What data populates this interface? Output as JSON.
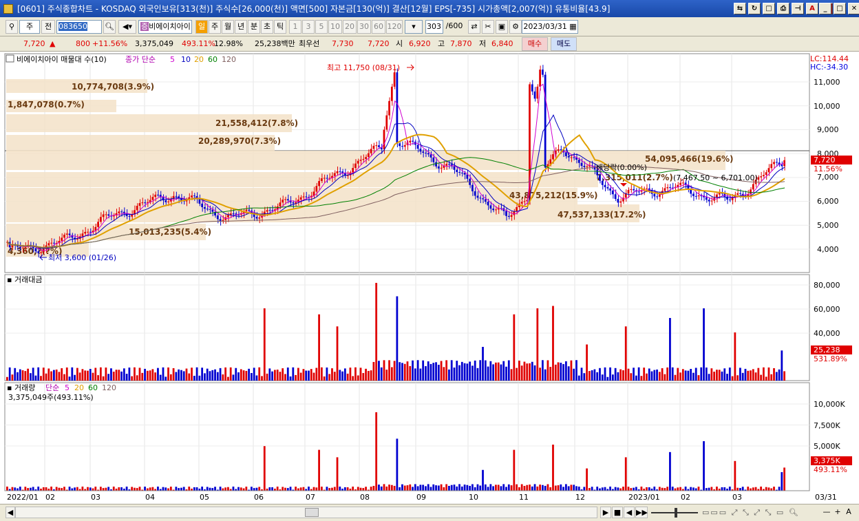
{
  "window": {
    "title": "[0601] 주식종합차트 - KOSDAQ 외국인보유[313(천)] 주식수[26,000(천)] 액면[500] 자본금[130(억)] 결산[12월] EPS[-735] 시가총액[2,007(억)] 유통비율[43.9]",
    "buttons": [
      "▣",
      "?"
    ]
  },
  "toolbar": {
    "period_select": "주",
    "prev_label": "전",
    "stock_code": "083650",
    "stock_name": "비에이치아이",
    "timeframes": [
      "일",
      "주",
      "월",
      "년",
      "분",
      "초",
      "틱"
    ],
    "minute_options": [
      "1",
      "3",
      "5",
      "10",
      "20",
      "30",
      "60",
      "120"
    ],
    "count": "303",
    "count_total": "/600",
    "date": "2023/03/31"
  },
  "quote": {
    "price": "7,720",
    "arrow": "▲",
    "change": "800",
    "change_pct": "+11.56%",
    "volume": "3,375,049",
    "volume_pct": "493.11%",
    "turnover": "12.98%",
    "amount": "25,238백만",
    "best_label": "최우선",
    "ask": "7,730",
    "bid": "7,720",
    "open_label": "시",
    "open": "6,920",
    "high_label": "고",
    "high": "7,870",
    "low_label": "저",
    "low": "6,840",
    "buy_label": "매수",
    "sell_label": "매도"
  },
  "price_pane": {
    "legend_name": "비에이치아이 매물대 수(10)",
    "legend_ma": "종가 단순",
    "ma_periods": [
      "5",
      "10",
      "20",
      "60",
      "120"
    ],
    "ma_colors": [
      "#d000d0",
      "#0000c0",
      "#e0a000",
      "#008000",
      "#806060"
    ],
    "lc": "LC:114.44",
    "hc": "HC:-34.30",
    "y_ticks": [
      "11,000",
      "10,000",
      "9,000",
      "8,000",
      "7,000",
      "6,000",
      "5,000",
      "4,000"
    ],
    "current_price": "7,720",
    "current_pct": "11.56%",
    "high_annot": "최고 11,750 (08/31)",
    "low_annot": "최저 3,600 (01/26)",
    "dividend_annot": "배당락(0.00%)",
    "range_annot": "(7,467.50 ~ 6,701.00)",
    "volume_profile": [
      {
        "label": "10,774,708(3.9%)"
      },
      {
        "label": "1,847,078(0.7%)"
      },
      {
        "label": "21,558,412(7.8%)"
      },
      {
        "label": "20,289,970(7.3%)"
      },
      {
        "label": "54,095,466(19.6%)"
      },
      {
        "label": "7,315,011(2.7%)"
      },
      {
        "label": "43,875,212(15.9%)"
      },
      {
        "label": "47,537,133(17.2%)"
      },
      {
        "label": "15,013,235(5.4%)"
      },
      {
        "label": "4,360,?(?%)"
      }
    ]
  },
  "amount_pane": {
    "legend": "거래대금",
    "y_ticks": [
      "80,000",
      "60,000",
      "40,000"
    ],
    "current": "25,238",
    "current_pct": "531.89%"
  },
  "volume_pane": {
    "legend": "거래량",
    "legend_ma": "단순",
    "ma_periods": [
      "5",
      "20",
      "60",
      "120"
    ],
    "subtitle": "3,375,049주(493.11%)",
    "y_ticks": [
      "10,000K",
      "7,500K",
      "5,000K"
    ],
    "current": "3,375K",
    "current_pct": "493.11%"
  },
  "x_axis": {
    "labels": [
      "2022/01",
      "02",
      "03",
      "04",
      "05",
      "06",
      "07",
      "08",
      "09",
      "10",
      "11",
      "12",
      "2023/01",
      "02",
      "03"
    ],
    "end_label": "03/31"
  },
  "chart_data": {
    "type": "candlestick",
    "title": "비에이치아이",
    "x_range": [
      "2022/01",
      "2023/03/31"
    ],
    "y_range": [
      3600,
      11750
    ],
    "high": {
      "value": 11750,
      "date": "08/31"
    },
    "low": {
      "value": 3600,
      "date": "01/26"
    },
    "monthly_close_approx": [
      {
        "x": "2022/01",
        "close": 3900
      },
      {
        "x": "02",
        "close": 4300
      },
      {
        "x": "03",
        "close": 5500
      },
      {
        "x": "04",
        "close": 6300
      },
      {
        "x": "05",
        "close": 5300
      },
      {
        "x": "06",
        "close": 5800
      },
      {
        "x": "07",
        "close": 7200
      },
      {
        "x": "08",
        "close": 8600
      },
      {
        "x": "09",
        "close": 7400
      },
      {
        "x": "10",
        "close": 5200
      },
      {
        "x": "11",
        "close": 8300
      },
      {
        "x": "12",
        "close": 6200
      },
      {
        "x": "2023/01",
        "close": 6600
      },
      {
        "x": "02",
        "close": 6000
      },
      {
        "x": "03",
        "close": 7720
      }
    ]
  },
  "statusbar": {
    "nav_buttons": [
      "▶",
      "■",
      "◀",
      "▶▶"
    ],
    "zoom_buttons": [
      "—",
      "+",
      "A"
    ]
  }
}
